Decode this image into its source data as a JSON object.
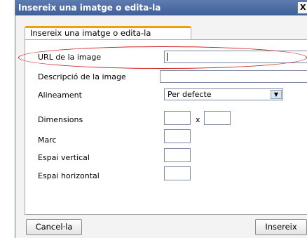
{
  "dialog": {
    "title": "Insereix una imatge o edita-la",
    "close_glyph": "X"
  },
  "tab": {
    "label": "Insereix una imatge o edita-la"
  },
  "fields": {
    "url_label": "URL de la image",
    "url_value": "",
    "description_label": "Descripció de la image",
    "description_value": "",
    "alignment_label": "Alineament",
    "alignment_value": "Per defecte",
    "dimensions_label": "Dimensions",
    "dimensions_separator": "x",
    "border_label": "Marc",
    "vspace_label": "Espai vertical",
    "hspace_label": "Espai horizontal"
  },
  "buttons": {
    "cancel": "Cancel·la",
    "insert": "Insereix"
  },
  "highlight": {
    "color": "#cc1a1a"
  }
}
